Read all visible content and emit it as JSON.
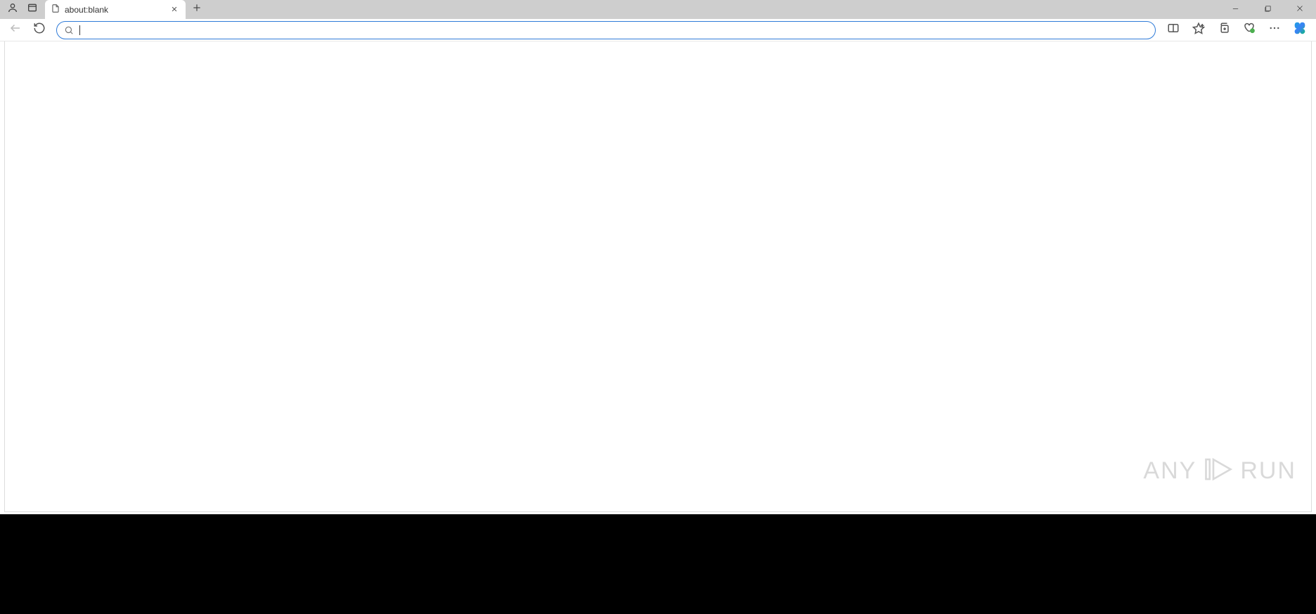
{
  "tab": {
    "title": "about:blank"
  },
  "address": {
    "value": "",
    "placeholder": ""
  },
  "watermark": {
    "left": "ANY",
    "right": "RUN"
  },
  "icons": {
    "profile": "profile-icon",
    "tab_actions": "tab-actions-icon",
    "page": "page-icon",
    "close": "close-icon",
    "new_tab": "plus-icon",
    "minimize": "minimize-icon",
    "maximize": "maximize-icon",
    "window_close": "window-close-icon",
    "back": "back-icon",
    "refresh": "refresh-icon",
    "search": "search-icon",
    "split_screen": "split-screen-icon",
    "favorites": "star-icon",
    "collections": "collections-icon",
    "performance": "browser-essentials-icon",
    "more": "more-icon",
    "copilot": "copilot-icon"
  }
}
